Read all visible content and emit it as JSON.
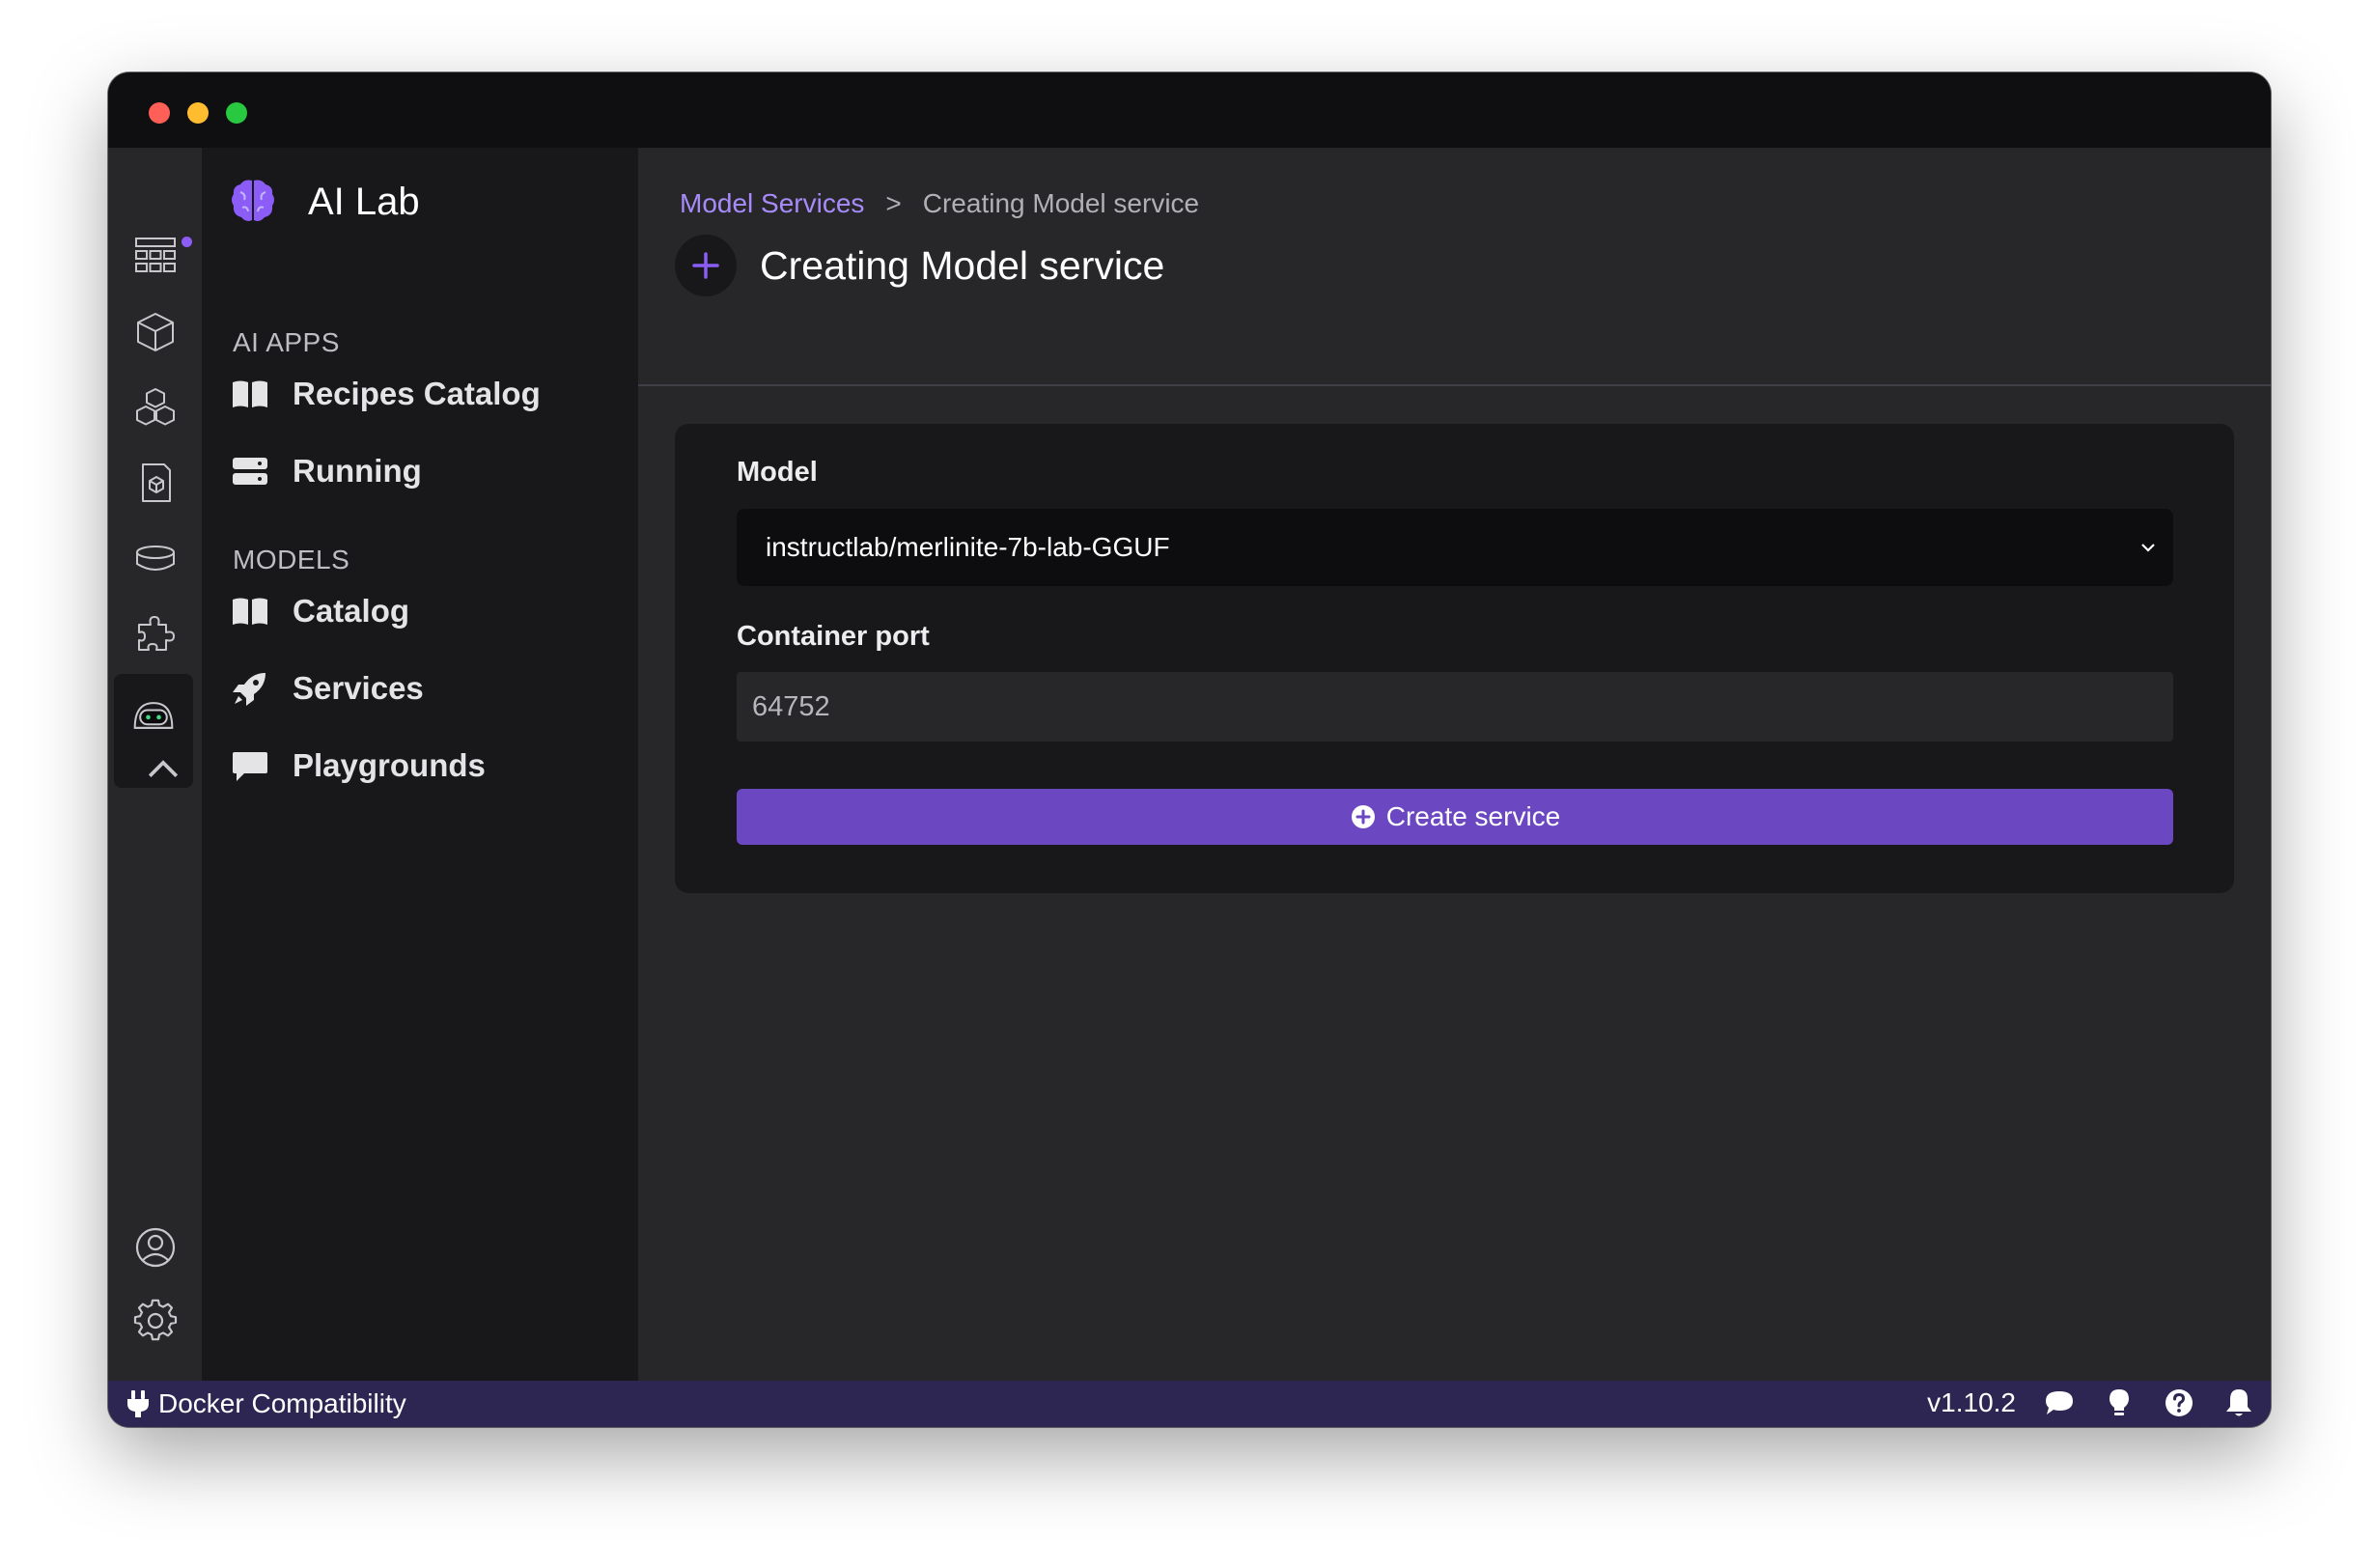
{
  "app": {
    "title": "AI Lab"
  },
  "nav": {
    "sections": [
      {
        "label": "AI APPS",
        "items": [
          {
            "label": "Recipes Catalog",
            "icon": "book-open-icon"
          },
          {
            "label": "Running",
            "icon": "server-icon"
          }
        ]
      },
      {
        "label": "MODELS",
        "items": [
          {
            "label": "Catalog",
            "icon": "book-open-icon"
          },
          {
            "label": "Services",
            "icon": "rocket-icon"
          },
          {
            "label": "Playgrounds",
            "icon": "message-icon"
          }
        ]
      }
    ]
  },
  "breadcrumb": {
    "link": "Model Services",
    "separator": ">",
    "current": "Creating Model service"
  },
  "page": {
    "title": "Creating Model service"
  },
  "form": {
    "model_label": "Model",
    "model_value": "instructlab/merlinite-7b-lab-GGUF",
    "port_label": "Container port",
    "port_value": "64752",
    "submit_label": "Create service"
  },
  "statusbar": {
    "left_label": "Docker Compatibility",
    "version": "v1.10.2"
  },
  "colors": {
    "accent": "#a78bfa",
    "button": "#6b47c1",
    "statusbar": "#2e2652"
  }
}
